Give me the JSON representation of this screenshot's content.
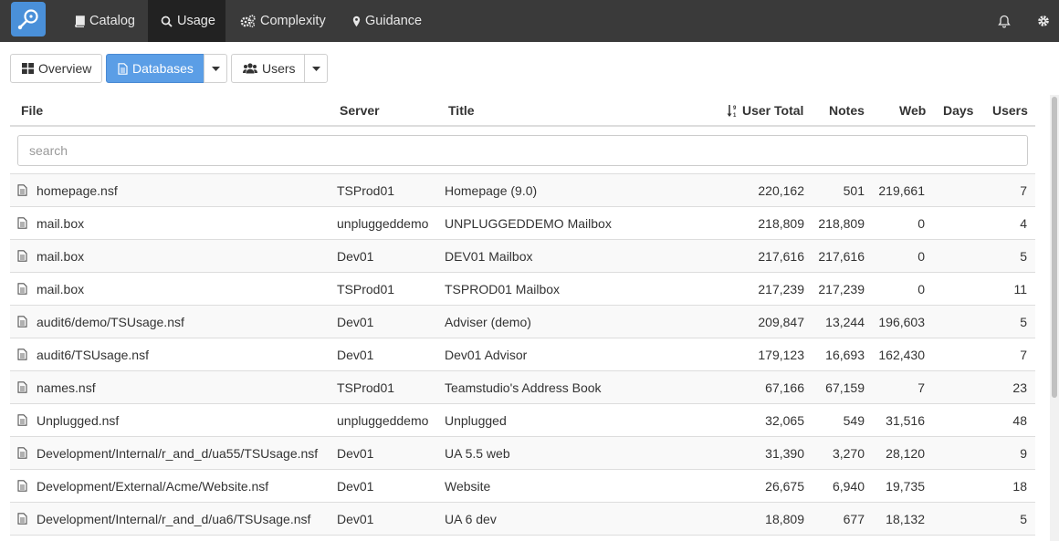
{
  "nav": {
    "items": [
      {
        "label": "Catalog",
        "icon": "book-icon"
      },
      {
        "label": "Usage",
        "icon": "search-icon"
      },
      {
        "label": "Complexity",
        "icon": "cogs-icon"
      },
      {
        "label": "Guidance",
        "icon": "map-marker-icon"
      }
    ],
    "active": "Usage"
  },
  "toolbar": {
    "overview_label": "Overview",
    "databases_label": "Databases",
    "users_label": "Users"
  },
  "table": {
    "columns": [
      "File",
      "Server",
      "Title",
      "User Total",
      "Notes",
      "Web",
      "Days",
      "Users"
    ],
    "search_placeholder": "search",
    "rows": [
      {
        "file": "homepage.nsf",
        "server": "TSProd01",
        "title": "Homepage (9.0)",
        "user_total": "220,162",
        "notes": "501",
        "web": "219,661",
        "days": "",
        "users": "7"
      },
      {
        "file": "mail.box",
        "server": "unpluggeddemo",
        "title": "UNPLUGGEDDEMO Mailbox",
        "user_total": "218,809",
        "notes": "218,809",
        "web": "0",
        "days": "",
        "users": "4"
      },
      {
        "file": "mail.box",
        "server": "Dev01",
        "title": "DEV01 Mailbox",
        "user_total": "217,616",
        "notes": "217,616",
        "web": "0",
        "days": "",
        "users": "5"
      },
      {
        "file": "mail.box",
        "server": "TSProd01",
        "title": "TSPROD01 Mailbox",
        "user_total": "217,239",
        "notes": "217,239",
        "web": "0",
        "days": "",
        "users": "11"
      },
      {
        "file": "audit6/demo/TSUsage.nsf",
        "server": "Dev01",
        "title": "Adviser (demo)",
        "user_total": "209,847",
        "notes": "13,244",
        "web": "196,603",
        "days": "",
        "users": "5"
      },
      {
        "file": "audit6/TSUsage.nsf",
        "server": "Dev01",
        "title": "Dev01 Advisor",
        "user_total": "179,123",
        "notes": "16,693",
        "web": "162,430",
        "days": "",
        "users": "7"
      },
      {
        "file": "names.nsf",
        "server": "TSProd01",
        "title": "Teamstudio's Address Book",
        "user_total": "67,166",
        "notes": "67,159",
        "web": "7",
        "days": "",
        "users": "23"
      },
      {
        "file": "Unplugged.nsf",
        "server": "unpluggeddemo",
        "title": "Unplugged",
        "user_total": "32,065",
        "notes": "549",
        "web": "31,516",
        "days": "",
        "users": "48"
      },
      {
        "file": "Development/Internal/r_and_d/ua55/TSUsage.nsf",
        "server": "Dev01",
        "title": "UA 5.5 web",
        "user_total": "31,390",
        "notes": "3,270",
        "web": "28,120",
        "days": "",
        "users": "9"
      },
      {
        "file": "Development/External/Acme/Website.nsf",
        "server": "Dev01",
        "title": "Website",
        "user_total": "26,675",
        "notes": "6,940",
        "web": "19,735",
        "days": "",
        "users": "18"
      },
      {
        "file": "Development/Internal/r_and_d/ua6/TSUsage.nsf",
        "server": "Dev01",
        "title": "UA 6 dev",
        "user_total": "18,809",
        "notes": "677",
        "web": "18,132",
        "days": "",
        "users": "5"
      }
    ]
  },
  "colors": {
    "nav_bg": "#3a3a3a",
    "nav_active": "#222222",
    "primary": "#5b9ee6",
    "logo": "#4a90d9"
  }
}
